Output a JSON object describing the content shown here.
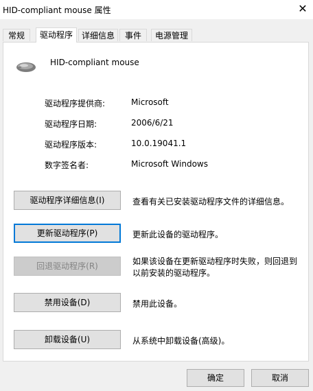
{
  "window": {
    "title": "HID-compliant mouse 属性",
    "close_glyph": "✕"
  },
  "tabs": [
    {
      "label": "常规",
      "active": false
    },
    {
      "label": "驱动程序",
      "active": true
    },
    {
      "label": "详细信息",
      "active": false
    },
    {
      "label": "事件",
      "active": false
    },
    {
      "label": "电源管理",
      "active": false
    }
  ],
  "device": {
    "name": "HID-compliant mouse",
    "icon": "mouse-icon"
  },
  "properties": [
    {
      "label": "驱动程序提供商:",
      "value": "Microsoft"
    },
    {
      "label": "驱动程序日期:",
      "value": "2006/6/21"
    },
    {
      "label": "驱动程序版本:",
      "value": "10.0.19041.1"
    },
    {
      "label": "数字签名者:",
      "value": "Microsoft Windows"
    }
  ],
  "actions": [
    {
      "label": "驱动程序详细信息(I)",
      "description": "查看有关已安装驱动程序文件的详细信息。",
      "enabled": true,
      "focused": false
    },
    {
      "label": "更新驱动程序(P)",
      "description": "更新此设备的驱动程序。",
      "enabled": true,
      "focused": true
    },
    {
      "label": "回退驱动程序(R)",
      "description": "如果该设备在更新驱动程序时失败，则回退到以前安装的驱动程序。",
      "enabled": false,
      "focused": false
    },
    {
      "label": "禁用设备(D)",
      "description": "禁用此设备。",
      "enabled": true,
      "focused": false
    },
    {
      "label": "卸载设备(U)",
      "description": "从系统中卸载设备(高级)。",
      "enabled": true,
      "focused": false
    }
  ],
  "footer": {
    "ok_label": "确定",
    "cancel_label": "取消"
  }
}
